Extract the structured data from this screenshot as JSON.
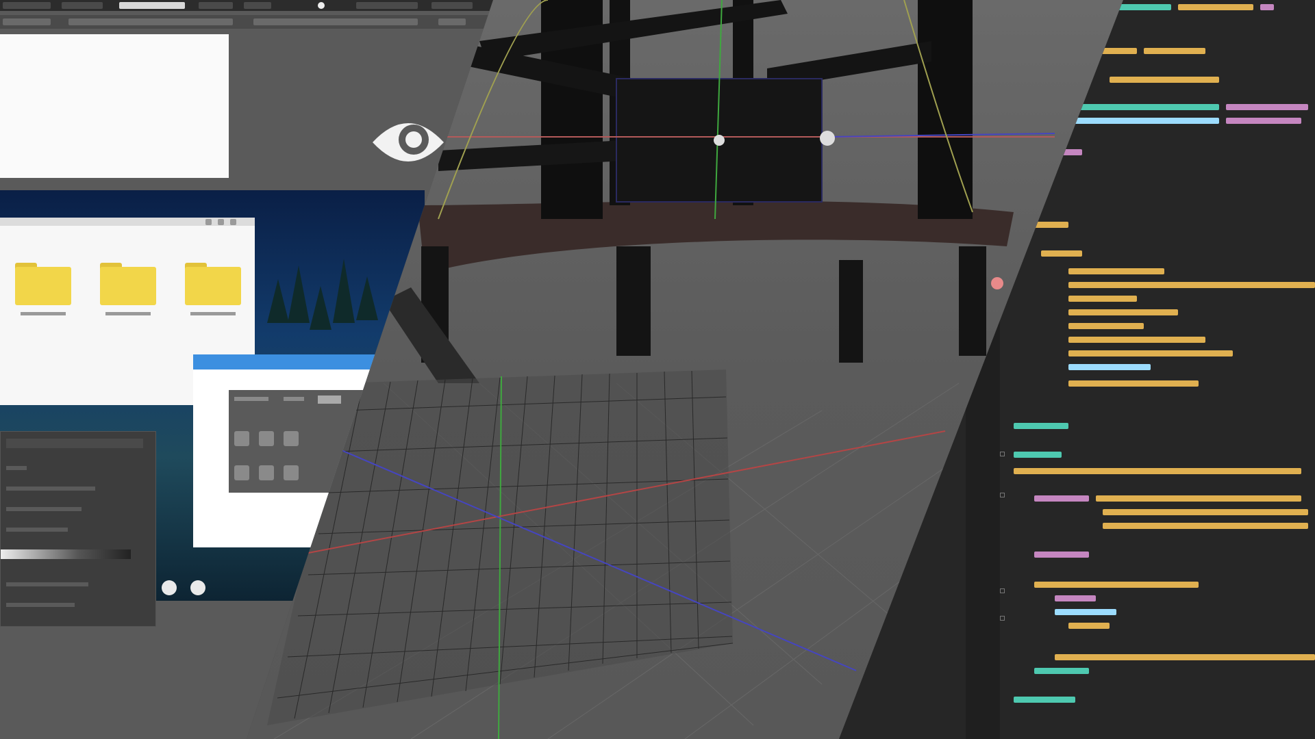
{
  "colors": {
    "folder": "#f2d649",
    "dialog_titlebar": "#3c8fe0",
    "axis_x": "#b44545",
    "axis_y": "#3fa83f",
    "axis_z": "#4545c0",
    "code_keyword": "#c586c0",
    "code_string": "#e0b050",
    "code_type": "#4ec9b0",
    "code_plain": "#9cdcfe",
    "code_comment": "#6a9955"
  },
  "icons": {
    "visibility": "eye-icon",
    "folder": "folder-icon",
    "dock_items": [
      "dock-circle-icon",
      "dock-circle-icon"
    ]
  },
  "viewport": {
    "contents": [
      "chair-model",
      "mesh-grid-object",
      "axis-gizmo"
    ]
  }
}
